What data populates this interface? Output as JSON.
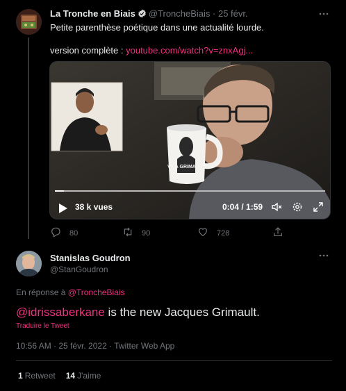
{
  "tweet1": {
    "author_name": "La Tronche en Biais",
    "handle": "@TroncheBiais",
    "time": "· 25 févr.",
    "text": "Petite parenthèse poétique dans une actualité lourde.",
    "link_prefix": "version complète : ",
    "link": "youtube.com/watch?v=znxAgj...",
    "video": {
      "views": "38 k vues",
      "time": "0:04 / 1:59",
      "progress": 0.034,
      "mug_text": "VIVA GRIMAULT"
    },
    "actions": {
      "replies": "80",
      "retweets": "90",
      "likes": "728"
    }
  },
  "tweet2": {
    "author_name": "Stanislas Goudron",
    "handle": "@StanGoudron",
    "reply_prefix": "En réponse à ",
    "reply_to": "@TroncheBiais",
    "mention": "@idrissaberkane",
    "text": " is the new Jacques Grimault.",
    "translate": "Traduire le Tweet",
    "meta": "10:56 AM · 25 févr. 2022 · Twitter Web App",
    "retweets_count": "1",
    "retweets_label": "Retweet",
    "likes_count": "14",
    "likes_label": "J'aime"
  },
  "colors": {
    "accent": "#f0307f",
    "background": "#000000",
    "secondary": "#71767b"
  },
  "icons": [
    "more-icon",
    "verified-icon",
    "reply-icon",
    "retweet-icon",
    "like-icon",
    "share-icon",
    "play-icon",
    "volume-icon",
    "settings-icon",
    "fullscreen-icon"
  ]
}
